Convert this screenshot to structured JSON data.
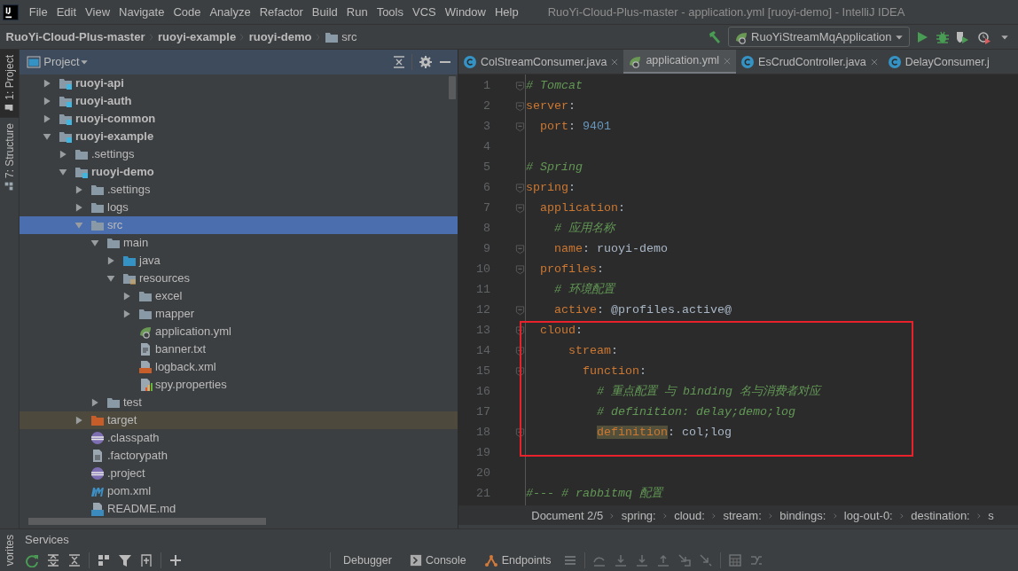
{
  "menu": [
    "File",
    "Edit",
    "View",
    "Navigate",
    "Code",
    "Analyze",
    "Refactor",
    "Build",
    "Run",
    "Tools",
    "VCS",
    "Window",
    "Help"
  ],
  "window": {
    "title": "RuoYi-Cloud-Plus-master - application.yml [ruoyi-demo] - IntelliJ IDEA"
  },
  "breadcrumbs": [
    {
      "label": "RuoYi-Cloud-Plus-master",
      "kind": "module"
    },
    {
      "label": "ruoyi-example",
      "kind": "module"
    },
    {
      "label": "ruoyi-demo",
      "kind": "module"
    },
    {
      "label": "src",
      "kind": "folder"
    }
  ],
  "run_configuration": {
    "label": "RuoYiStreamMqApplication"
  },
  "side_tabs": [
    {
      "label": "1: Project",
      "selected": true,
      "kind": "project"
    },
    {
      "label": "7: Structure",
      "selected": false,
      "kind": "structure"
    }
  ],
  "side_tabs_bottom": [
    {
      "label": "vorites",
      "selected": false
    }
  ],
  "project_panel": {
    "title": "Project",
    "tree": [
      {
        "label": "ruoyi-api",
        "kind": "module",
        "expanded": false,
        "selected": false,
        "excluded": false
      },
      {
        "label": "ruoyi-auth",
        "kind": "module",
        "expanded": false,
        "selected": false,
        "excluded": false
      },
      {
        "label": "ruoyi-common",
        "kind": "module",
        "expanded": false,
        "selected": false,
        "excluded": false
      },
      {
        "label": "ruoyi-example",
        "kind": "module",
        "expanded": true,
        "selected": false,
        "excluded": false,
        "children": [
          {
            "label": ".settings",
            "kind": "folder",
            "expanded": false,
            "selected": false,
            "excluded": false
          },
          {
            "label": "ruoyi-demo",
            "kind": "module",
            "expanded": true,
            "selected": false,
            "excluded": false,
            "children": [
              {
                "label": ".settings",
                "kind": "folder",
                "expanded": false,
                "selected": false,
                "excluded": false
              },
              {
                "label": "logs",
                "kind": "folder",
                "expanded": false,
                "selected": false,
                "excluded": false
              },
              {
                "label": "src",
                "kind": "folder",
                "expanded": true,
                "selected": true,
                "excluded": false,
                "children": [
                  {
                    "label": "main",
                    "kind": "folder",
                    "expanded": true,
                    "selected": false,
                    "excluded": false,
                    "children": [
                      {
                        "label": "java",
                        "kind": "source",
                        "expanded": false,
                        "selected": false,
                        "excluded": false
                      },
                      {
                        "label": "resources",
                        "kind": "resources",
                        "expanded": true,
                        "selected": false,
                        "excluded": false,
                        "children": [
                          {
                            "label": "excel",
                            "kind": "folder",
                            "expanded": false,
                            "selected": false,
                            "excluded": false
                          },
                          {
                            "label": "mapper",
                            "kind": "folder",
                            "expanded": false,
                            "selected": false,
                            "excluded": false
                          },
                          {
                            "label": "application.yml",
                            "kind": "spring",
                            "selected": false,
                            "excluded": false
                          },
                          {
                            "label": "banner.txt",
                            "kind": "text",
                            "selected": false,
                            "excluded": false
                          },
                          {
                            "label": "logback.xml",
                            "kind": "xml",
                            "selected": false,
                            "excluded": false
                          },
                          {
                            "label": "spy.properties",
                            "kind": "properties",
                            "selected": false,
                            "excluded": false
                          }
                        ]
                      }
                    ]
                  },
                  {
                    "label": "test",
                    "kind": "folder",
                    "expanded": false,
                    "selected": false,
                    "excluded": false
                  }
                ]
              },
              {
                "label": "target",
                "kind": "excluded",
                "expanded": false,
                "selected": false,
                "excluded": true
              },
              {
                "label": ".classpath",
                "kind": "eclipse",
                "selected": false,
                "excluded": false
              },
              {
                "label": ".factorypath",
                "kind": "file",
                "selected": false,
                "excluded": false
              },
              {
                "label": ".project",
                "kind": "eclipse",
                "selected": false,
                "excluded": false
              },
              {
                "label": "pom.xml",
                "kind": "maven",
                "selected": false,
                "excluded": false
              },
              {
                "label": "README.md",
                "kind": "markdown",
                "selected": false,
                "excluded": false
              }
            ]
          }
        ]
      }
    ]
  },
  "editor_tabs": [
    {
      "label": "ColStreamConsumer.java",
      "kind": "class",
      "selected": false,
      "closable": true
    },
    {
      "label": "application.yml",
      "kind": "spring",
      "selected": true,
      "closable": true
    },
    {
      "label": "EsCrudController.java",
      "kind": "class",
      "selected": false,
      "closable": true
    },
    {
      "label": "DelayConsumer.j",
      "kind": "class",
      "selected": false,
      "closable": false
    }
  ],
  "code_lines": [
    {
      "number": "1",
      "fold": true,
      "tokens": [
        {
          "kind": "comment",
          "text": "# Tomcat"
        }
      ]
    },
    {
      "number": "2",
      "fold": true,
      "tokens": [
        {
          "kind": "key",
          "text": "server"
        },
        {
          "kind": "punct",
          "text": ":"
        }
      ]
    },
    {
      "number": "3",
      "fold": true,
      "tokens": [
        {
          "kind": "key",
          "text": "  port"
        },
        {
          "kind": "punct",
          "text": ": "
        },
        {
          "kind": "number",
          "text": "9401"
        }
      ]
    },
    {
      "number": "4",
      "fold": false
    },
    {
      "number": "5",
      "fold": false,
      "tokens": [
        {
          "kind": "comment",
          "text": "# Spring"
        }
      ]
    },
    {
      "number": "6",
      "fold": true,
      "tokens": [
        {
          "kind": "key",
          "text": "spring"
        },
        {
          "kind": "punct",
          "text": ":"
        }
      ]
    },
    {
      "number": "7",
      "fold": true,
      "tokens": [
        {
          "kind": "key",
          "text": "  application"
        },
        {
          "kind": "punct",
          "text": ":"
        }
      ]
    },
    {
      "number": "8",
      "fold": false,
      "tokens": [
        {
          "kind": "comment",
          "text": "    # 应用名称"
        }
      ]
    },
    {
      "number": "9",
      "fold": true,
      "tokens": [
        {
          "kind": "key",
          "text": "    name"
        },
        {
          "kind": "punct",
          "text": ": "
        },
        {
          "kind": "value",
          "text": "ruoyi-demo"
        }
      ]
    },
    {
      "number": "10",
      "fold": true,
      "tokens": [
        {
          "kind": "key",
          "text": "  profiles"
        },
        {
          "kind": "punct",
          "text": ":"
        }
      ]
    },
    {
      "number": "11",
      "fold": false,
      "tokens": [
        {
          "kind": "comment",
          "text": "    # 环境配置"
        }
      ]
    },
    {
      "number": "12",
      "fold": true,
      "tokens": [
        {
          "kind": "key",
          "text": "    active"
        },
        {
          "kind": "punct",
          "text": ": "
        },
        {
          "kind": "value",
          "text": "@profiles.active@"
        }
      ]
    },
    {
      "number": "13",
      "fold": true,
      "tokens": [
        {
          "kind": "key",
          "text": "  cloud"
        },
        {
          "kind": "punct",
          "text": ":"
        }
      ]
    },
    {
      "number": "14",
      "fold": true,
      "tokens": [
        {
          "kind": "key",
          "text": "      stream"
        },
        {
          "kind": "punct",
          "text": ":"
        }
      ]
    },
    {
      "number": "15",
      "fold": true,
      "tokens": [
        {
          "kind": "key",
          "text": "        function"
        },
        {
          "kind": "punct",
          "text": ":"
        }
      ]
    },
    {
      "number": "16",
      "fold": false,
      "tokens": [
        {
          "kind": "comment",
          "text": "          # 重点配置 与 binding 名与消费者对应"
        }
      ]
    },
    {
      "number": "17",
      "fold": false,
      "tokens": [
        {
          "kind": "comment",
          "text": "          # definition: delay;demo;log"
        }
      ]
    },
    {
      "number": "18",
      "fold": true,
      "tokens": [
        {
          "kind": "occurrence",
          "text": "          definition"
        },
        {
          "kind": "punct",
          "text": ": "
        },
        {
          "kind": "value",
          "text": "col;log"
        }
      ]
    },
    {
      "number": "19",
      "fold": false
    },
    {
      "number": "20",
      "fold": false
    },
    {
      "number": "21",
      "fold": false,
      "tokens": [
        {
          "kind": "comment",
          "text": "#--- # rabbitmq 配置"
        }
      ]
    }
  ],
  "editor_breadcrumbs": [
    "Document 2/5",
    "spring:",
    "cloud:",
    "stream:",
    "bindings:",
    "log-out-0:",
    "destination:",
    "s"
  ],
  "services": {
    "title": "Services",
    "tabs": [
      {
        "label": "Debugger",
        "kind": "plain"
      },
      {
        "label": "Console",
        "kind": "console"
      },
      {
        "label": "Endpoints",
        "kind": "endpoints"
      }
    ]
  }
}
